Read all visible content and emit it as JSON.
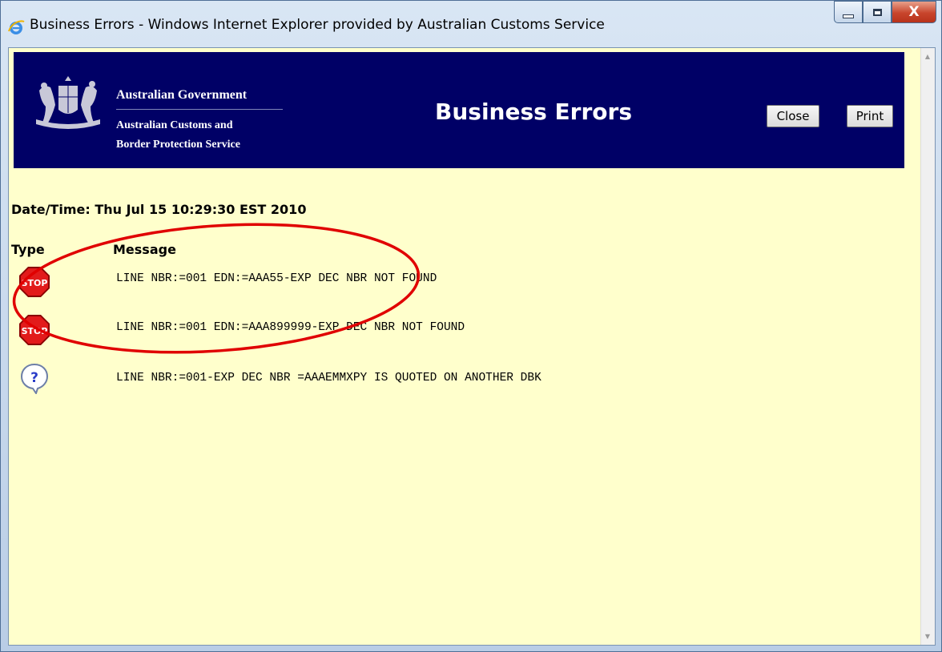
{
  "window": {
    "title": "Business Errors - Windows Internet Explorer provided by Australian Customs Service",
    "close_glyph": "X"
  },
  "header": {
    "gov_name": "Australian Government",
    "agency_line1": "Australian Customs and",
    "agency_line2": "Border Protection Service",
    "page_title": "Business Errors",
    "close_label": "Close",
    "print_label": "Print",
    "banner_color": "#000066"
  },
  "content": {
    "datetime": "Date/Time: Thu Jul 15 10:29:30 EST 2010",
    "col_type": "Type",
    "col_message": "Message",
    "rows": [
      {
        "icon": "stop-icon",
        "icon_text": "STOP",
        "message": "LINE NBR:=001 EDN:=AAA55-EXP DEC NBR NOT FOUND"
      },
      {
        "icon": "stop-icon",
        "icon_text": "STOP",
        "message": "LINE NBR:=001 EDN:=AAA899999-EXP DEC NBR NOT FOUND"
      },
      {
        "icon": "question-icon",
        "icon_text": "?",
        "message": "LINE NBR:=001-EXP DEC NBR =AAAEMMXPY IS QUOTED ON ANOTHER DBK"
      }
    ],
    "background_color": "#ffffcc"
  },
  "annotation": {
    "color": "#e00000",
    "shape": "ellipse"
  }
}
